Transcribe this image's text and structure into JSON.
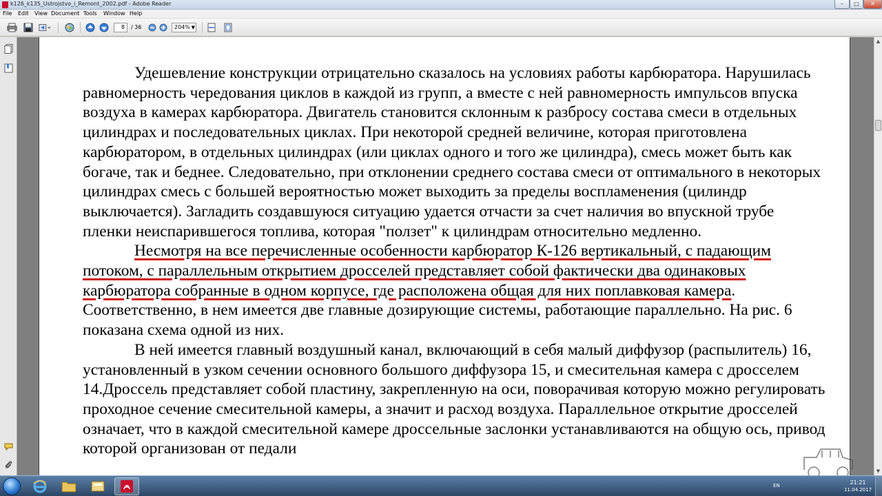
{
  "window": {
    "title": "k126_k135_Ustrojstvo_i_Remont_2002.pdf - Adobe Reader",
    "min": "–",
    "max": "□",
    "close": "✕"
  },
  "menu": [
    "File",
    "Edit",
    "View",
    "Document",
    "Tools",
    "Window",
    "Help"
  ],
  "toolbar": {
    "page_current": "8",
    "page_total": "/ 36",
    "zoom": "204%"
  },
  "document": {
    "paragraphs": [
      {
        "text": "Удешевление конструкции отрицательно сказалось на условиях работы карбюратора. Нарушилась равномерность чередования циклов в каждой из групп, а вместе с ней равномерность импульсов впуска воздуха в камерах карбюратора. Двигатель становится склонным к разбросу состава смеси в отдельных цилиндрах и последовательных циклах. При некоторой средней величине, которая приготовлена карбюратором, в отдельных цилиндрах (или циклах одного и того же цилиндра), смесь может быть как богаче, так и беднее. Следовательно, при отклонении среднего состава смеси от оптимального в некоторых цилиндрах смесь с большей вероятностью может выходить за пределы воспламенения (цилиндр выключается). Загладить создавшуюся ситуацию удается отчасти за счет наличия во впускной трубе пленки неиспарившегося топлива, которая \"ползет\" к цилиндрам относительно медленно."
      },
      {
        "underlined": "Несмотря на все перечисленные особенности карбюратор К-126 вертикальный, с падающим потоком, с параллельным открытием дросселей представляет собой фактически два одинаковых карбюратора собранные в одном корпусе, где расположена общая для них поплавковая камера",
        "underline_color": "#d01818",
        "text": ". Соответственно, в нем имеется две главные дозирующие системы, работающие параллельно. На рис. 6 показана схема одной из них."
      },
      {
        "text": "В ней имеется главный воздушный канал, включающий в себя малый диффузор (распылитель) 16, установленный в узком сечении основного большого диффузора 15, и смесительная камера с дросселем 14.Дроссель представляет собой пластину, закрепленную на оси, поворачивая которую можно регулировать проходное сечение смесительной камеры, а значит и расход воздуха. Параллельное открытие дросселей означает, что в каждой смесительной камере дроссельные заслонки устанавливаются на общую ось, привод которой организован от педали"
      }
    ]
  },
  "taskbar": {
    "lang": "EN",
    "time": "21:21",
    "date": "11.04.2017"
  }
}
